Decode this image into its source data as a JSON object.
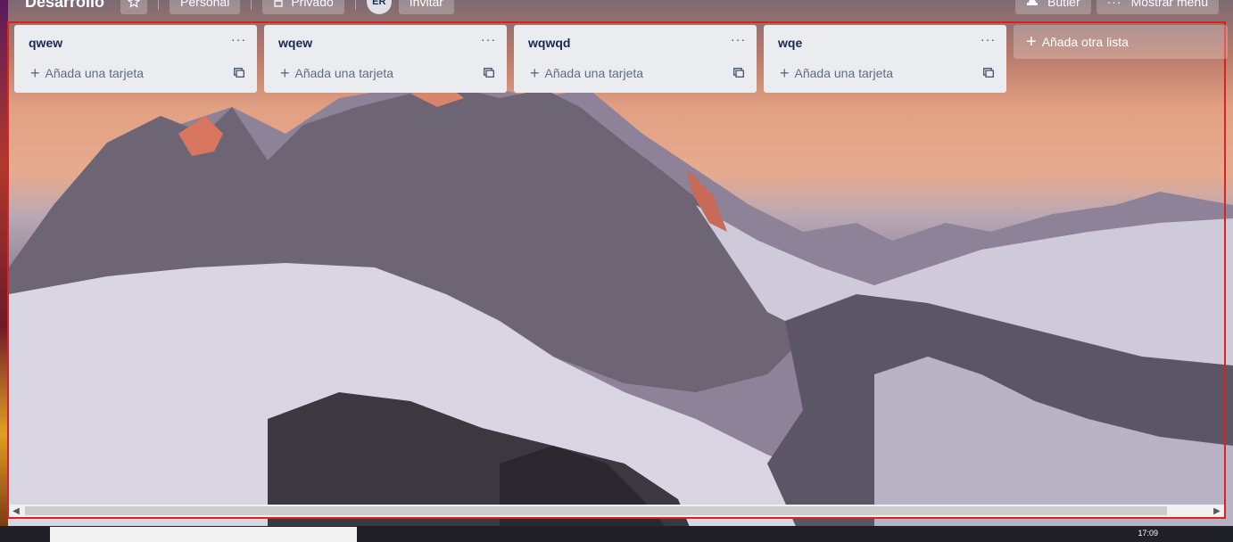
{
  "header": {
    "board_title": "Desarrollo",
    "star_icon": "star-icon",
    "personal_label": "Personal",
    "privado_label": "Privado",
    "avatar_initials": "ER",
    "invite_label": "Invitar",
    "butler_label": "Butler",
    "menu_label": "Mostrar menú"
  },
  "lists": [
    {
      "title": "qwew",
      "add_card_label": "Añada una tarjeta"
    },
    {
      "title": "wqew",
      "add_card_label": "Añada una tarjeta"
    },
    {
      "title": "wqwqd",
      "add_card_label": "Añada una tarjeta"
    },
    {
      "title": "wqe",
      "add_card_label": "Añada una tarjeta"
    }
  ],
  "add_list_label": "Añada otra lista",
  "list_menu_glyph": "···",
  "taskbar": {
    "clock": "17:09"
  },
  "colors": {
    "list_bg": "#ebecf0",
    "title_text": "#172b4d",
    "muted_text": "#5e6c84",
    "highlight_border": "#e02020"
  }
}
